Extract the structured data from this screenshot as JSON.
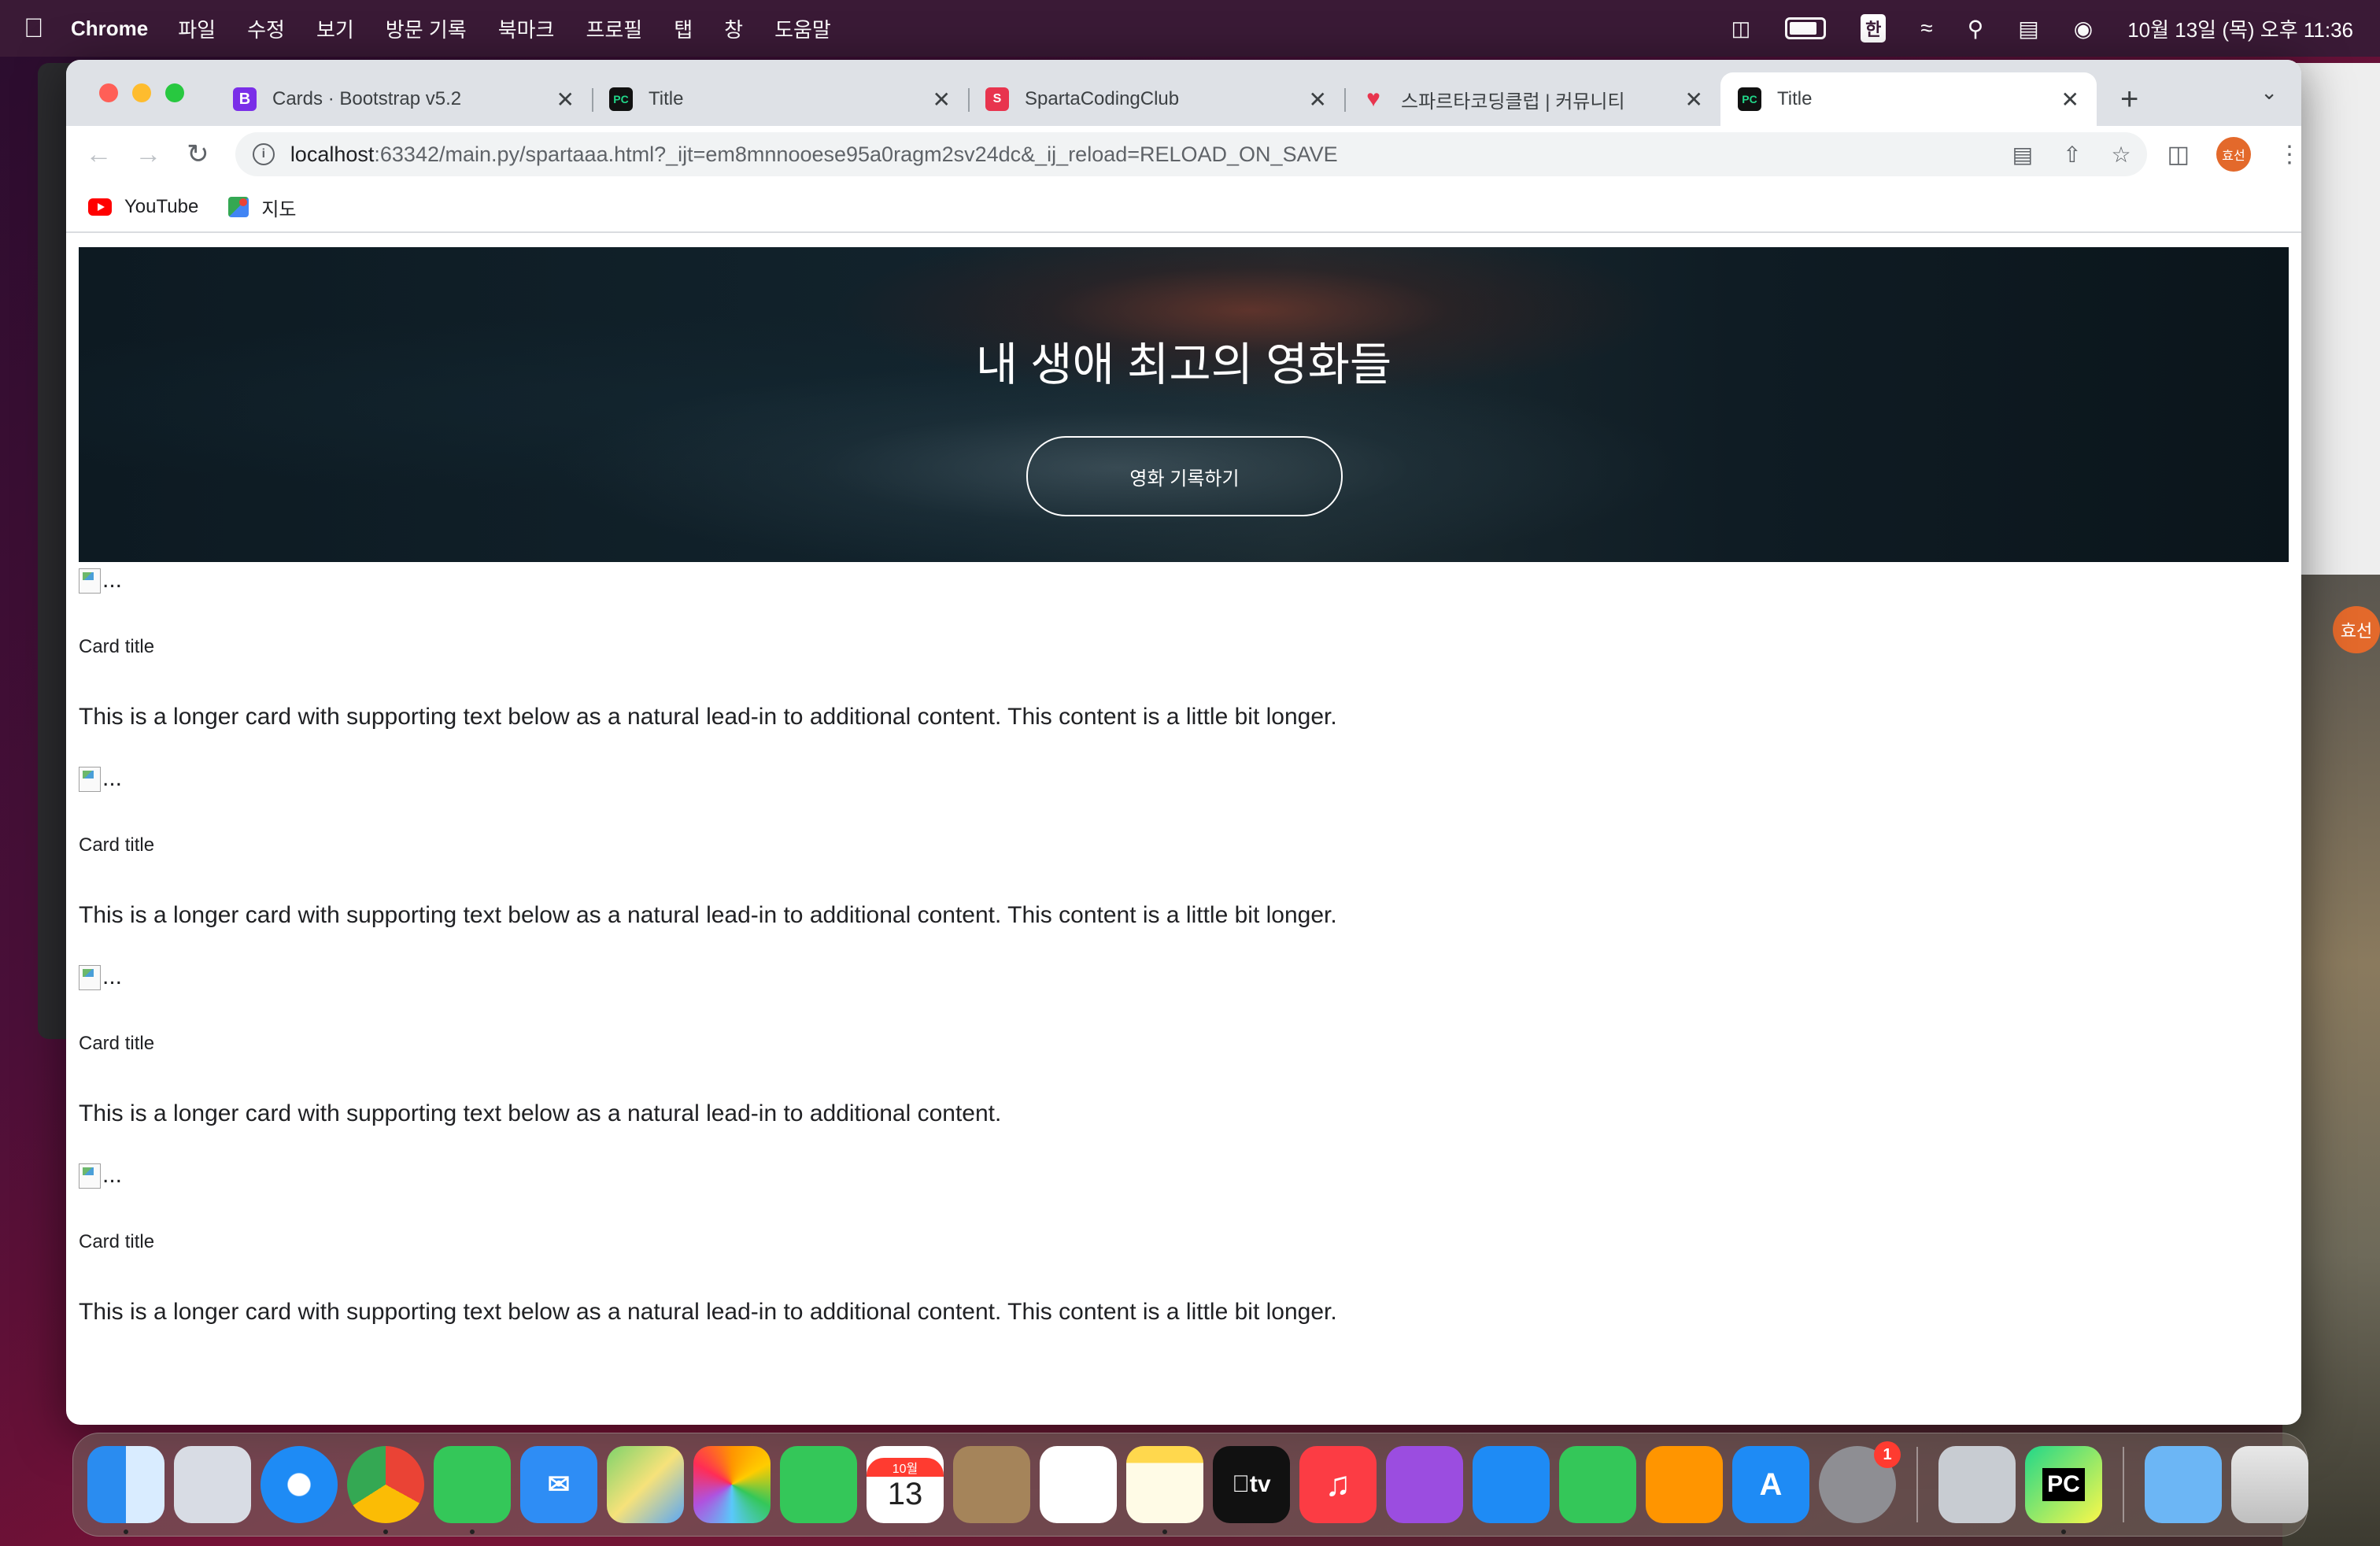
{
  "menubar": {
    "app_name": "Chrome",
    "menus": [
      "파일",
      "수정",
      "보기",
      "방문 기록",
      "북마크",
      "프로필",
      "탭",
      "창",
      "도움말"
    ],
    "ime": "한",
    "datetime": "10월 13일 (목) 오후 11:36"
  },
  "tabs": [
    {
      "title": "Cards · Bootstrap v5.2",
      "favicon": "B"
    },
    {
      "title": "Title",
      "favicon": "PC"
    },
    {
      "title": "SpartaCodingClub",
      "favicon": "S"
    },
    {
      "title": "스파르타코딩클럽 | 커뮤니티",
      "favicon": "heart"
    },
    {
      "title": "Title",
      "favicon": "PC"
    }
  ],
  "address": {
    "host": "localhost",
    "rest": ":63342/main.py/spartaaa.html?_ijt=em8mnnooese95a0ragm2sv24dc&_ij_reload=RELOAD_ON_SAVE"
  },
  "profile_initials": "효선",
  "bookmarks": [
    {
      "label": "YouTube"
    },
    {
      "label": "지도"
    }
  ],
  "hero": {
    "title": "내 생애 최고의 영화들",
    "button": "영화 기록하기"
  },
  "cards": [
    {
      "alt": "...",
      "title": "Card title",
      "text": "This is a longer card with supporting text below as a natural lead-in to additional content. This content is a little bit longer."
    },
    {
      "alt": "...",
      "title": "Card title",
      "text": "This is a longer card with supporting text below as a natural lead-in to additional content. This content is a little bit longer."
    },
    {
      "alt": "...",
      "title": "Card title",
      "text": "This is a longer card with supporting text below as a natural lead-in to additional content."
    },
    {
      "alt": "...",
      "title": "Card title",
      "text": "This is a longer card with supporting text below as a natural lead-in to additional content. This content is a little bit longer."
    }
  ],
  "dock": {
    "calendar_month": "10월",
    "calendar_day": "13",
    "settings_badge": "1"
  }
}
